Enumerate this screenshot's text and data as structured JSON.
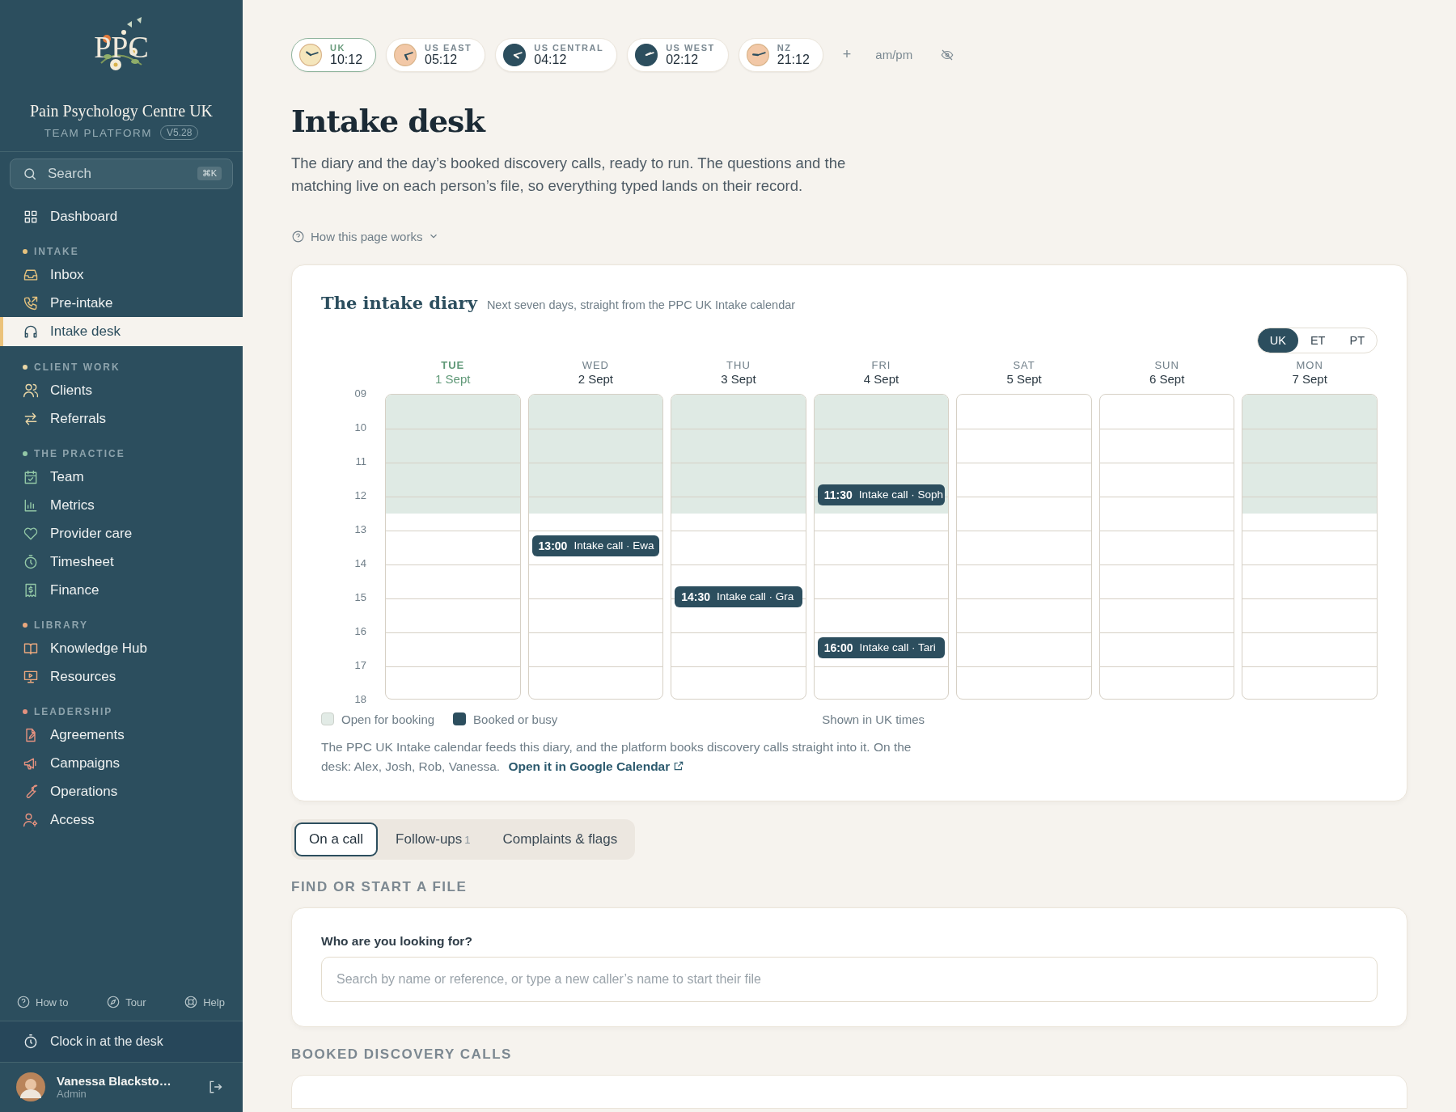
{
  "sidebar": {
    "logo_text": "PPC",
    "org_name": "Pain Psychology Centre UK",
    "subtitle": "TEAM PLATFORM",
    "version": "V5.28",
    "search": {
      "placeholder": "Search",
      "shortcut": "⌘K"
    },
    "top_items": [
      {
        "label": "Dashboard",
        "selected": false
      }
    ],
    "sections": [
      {
        "title": "INTAKE",
        "color": "#e6c27e",
        "items": [
          {
            "label": "Inbox",
            "selected": false
          },
          {
            "label": "Pre-intake",
            "selected": false
          },
          {
            "label": "Intake desk",
            "selected": true
          }
        ]
      },
      {
        "title": "CLIENT WORK",
        "color": "#e9d6a6",
        "items": [
          {
            "label": "Clients",
            "selected": false
          },
          {
            "label": "Referrals",
            "selected": false
          }
        ]
      },
      {
        "title": "THE PRACTICE",
        "color": "#92c7a6",
        "items": [
          {
            "label": "Team",
            "selected": false
          },
          {
            "label": "Metrics",
            "selected": false
          },
          {
            "label": "Provider care",
            "selected": false
          },
          {
            "label": "Timesheet",
            "selected": false
          },
          {
            "label": "Finance",
            "selected": false
          }
        ]
      },
      {
        "title": "LIBRARY",
        "color": "#eaa87e",
        "items": [
          {
            "label": "Knowledge Hub",
            "selected": false
          },
          {
            "label": "Resources",
            "selected": false
          }
        ]
      },
      {
        "title": "LEADERSHIP",
        "color": "#e3917f",
        "items": [
          {
            "label": "Agreements",
            "selected": false
          },
          {
            "label": "Campaigns",
            "selected": false
          },
          {
            "label": "Operations",
            "selected": false
          },
          {
            "label": "Access",
            "selected": false
          }
        ]
      }
    ],
    "footer_links": [
      "How to",
      "Tour",
      "Help"
    ],
    "clock_in": "Clock in at the desk",
    "user": {
      "name": "Vanessa Blacksto…",
      "role": "Admin"
    }
  },
  "clocks": {
    "zones": [
      {
        "label": "UK",
        "time": "10:12",
        "color": "#f5e6bc",
        "selected": true
      },
      {
        "label": "US EAST",
        "time": "05:12",
        "color": "#f2c8a7",
        "selected": false
      },
      {
        "label": "US CENTRAL",
        "time": "04:12",
        "color": "#2c4e5e",
        "selected": false
      },
      {
        "label": "US WEST",
        "time": "02:12",
        "color": "#2c4e5e",
        "selected": false
      },
      {
        "label": "NZ",
        "time": "21:12",
        "color": "#f2c8a7",
        "selected": false
      }
    ],
    "add": "+",
    "format": "am/pm"
  },
  "page": {
    "title": "Intake desk",
    "intro": "The diary and the day’s booked discovery calls, ready to run. The questions and the matching live on each person’s file, so everything typed lands on their record.",
    "help": {
      "label": "How this page works",
      "expanded": false
    }
  },
  "diary": {
    "title": "The intake diary",
    "subtitle": "Next seven days, straight from the PPC UK Intake calendar",
    "zones": [
      {
        "label": "UK",
        "selected": true
      },
      {
        "label": "ET",
        "selected": false
      },
      {
        "label": "PT",
        "selected": false
      }
    ],
    "hours": [
      "09",
      "10",
      "11",
      "12",
      "13",
      "14",
      "15",
      "16",
      "17",
      "18"
    ],
    "days": [
      {
        "weekday": "TUE",
        "date": "1 Sept",
        "today": true,
        "open": true
      },
      {
        "weekday": "WED",
        "date": "2 Sept",
        "today": false,
        "open": true,
        "events": [
          {
            "time": "13:00",
            "title": "Intake call · Ewa"
          }
        ]
      },
      {
        "weekday": "THU",
        "date": "3 Sept",
        "today": false,
        "open": true,
        "events": [
          {
            "time": "14:30",
            "title": "Intake call · Gra"
          }
        ]
      },
      {
        "weekday": "FRI",
        "date": "4 Sept",
        "today": false,
        "open": true,
        "events": [
          {
            "time": "11:30",
            "title": "Intake call · Soph"
          },
          {
            "time": "16:00",
            "title": "Intake call · Tari"
          }
        ]
      },
      {
        "weekday": "SAT",
        "date": "5 Sept",
        "today": false,
        "open": false
      },
      {
        "weekday": "SUN",
        "date": "6 Sept",
        "today": false,
        "open": false
      },
      {
        "weekday": "MON",
        "date": "7 Sept",
        "today": false,
        "open": true
      }
    ],
    "legend": [
      {
        "label": "Open for booking",
        "kind": "open"
      },
      {
        "label": "Booked or busy",
        "kind": "booked"
      }
    ],
    "timezone_note": "Shown in UK times",
    "note": "The PPC UK Intake calendar feeds this diary, and the platform books discovery calls straight into it. On the desk: Alex, Josh, Rob, Vanessa.",
    "link": "Open it in Google Calendar"
  },
  "tabs": [
    {
      "label": "On a call",
      "selected": true
    },
    {
      "label": "Follow-ups",
      "count": "1",
      "selected": false
    },
    {
      "label": "Complaints & flags",
      "selected": false
    }
  ],
  "find": {
    "heading": "FIND OR START A FILE",
    "label": "Who are you looking for?",
    "placeholder": "Search by name or reference, or type a new caller’s name to start their file"
  },
  "booked": {
    "heading": "BOOKED DISCOVERY CALLS"
  }
}
